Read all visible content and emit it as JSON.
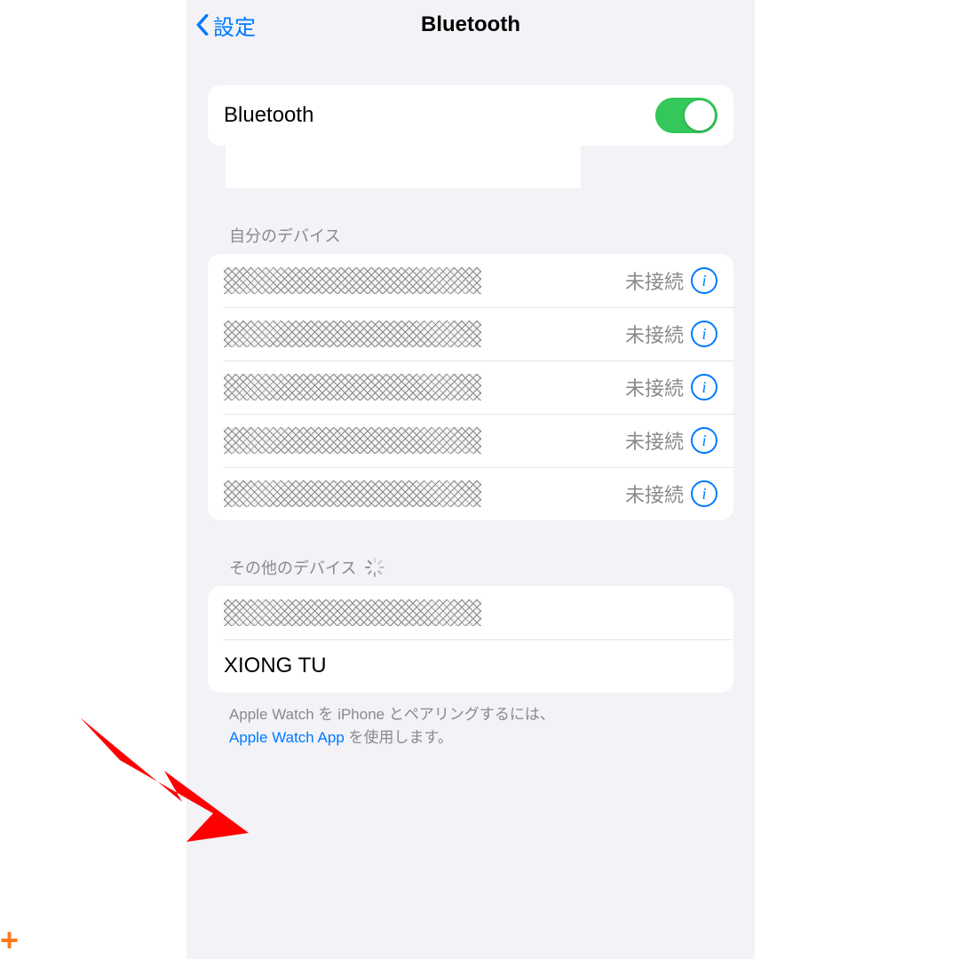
{
  "nav": {
    "back_label": "設定",
    "title": "Bluetooth"
  },
  "bluetooth_row": {
    "label": "Bluetooth",
    "enabled": true
  },
  "my_devices": {
    "header": "自分のデバイス",
    "items": [
      {
        "status": "未接続"
      },
      {
        "status": "未接続"
      },
      {
        "status": "未接続"
      },
      {
        "status": "未接続"
      },
      {
        "status": "未接続"
      }
    ]
  },
  "other_devices": {
    "header": "その他のデバイス",
    "items": [
      {
        "name_redacted": true
      },
      {
        "name": "XIONG TU"
      }
    ]
  },
  "footer": {
    "text_before": "Apple Watch を iPhone とペアリングするには、",
    "link": "Apple Watch App",
    "text_after": " を使用します。"
  }
}
